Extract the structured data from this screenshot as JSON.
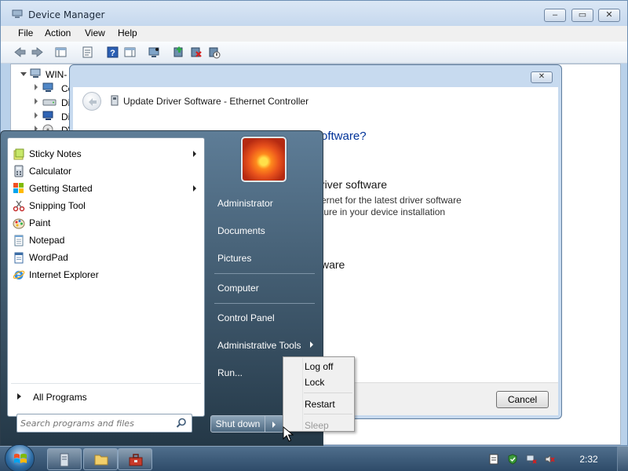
{
  "device_manager": {
    "title": "Device Manager",
    "menu": [
      "File",
      "Action",
      "View",
      "Help"
    ],
    "tree_root": "WIN-",
    "tree_items": [
      "Co",
      "Di",
      "Di",
      "DV"
    ],
    "buttons": {
      "minimize": "–",
      "maximize": "▭",
      "close": "✕"
    }
  },
  "dialog": {
    "title": "Update Driver Software - Ethernet Controller",
    "question_fragment": "oftware?",
    "option1_title_fragment": "river software",
    "option1_desc_line1": "ernet for the latest driver software",
    "option1_desc_line2": "ture in your device installation",
    "option2_title_fragment": "ware",
    "cancel_label": "Cancel",
    "close_glyph": "✕"
  },
  "start_menu": {
    "programs": [
      {
        "label": "Sticky Notes",
        "icon": "sticky-notes-icon",
        "has_arrow": true
      },
      {
        "label": "Calculator",
        "icon": "calculator-icon",
        "has_arrow": false
      },
      {
        "label": "Getting Started",
        "icon": "getting-started-icon",
        "has_arrow": true
      },
      {
        "label": "Snipping Tool",
        "icon": "snipping-tool-icon",
        "has_arrow": false
      },
      {
        "label": "Paint",
        "icon": "paint-icon",
        "has_arrow": false
      },
      {
        "label": "Notepad",
        "icon": "notepad-icon",
        "has_arrow": false
      },
      {
        "label": "WordPad",
        "icon": "wordpad-icon",
        "has_arrow": false
      },
      {
        "label": "Internet Explorer",
        "icon": "internet-explorer-icon",
        "has_arrow": false
      }
    ],
    "all_programs": "All Programs",
    "search_placeholder": "Search programs and files",
    "right_links": [
      "Administrator",
      "Documents",
      "Pictures",
      "Computer",
      "Control Panel",
      "Administrative Tools",
      "Run..."
    ],
    "shutdown_label": "Shut down"
  },
  "shutdown_submenu": {
    "items": [
      "Log off",
      "Lock",
      "Restart",
      "Sleep"
    ],
    "disabled": "Sleep"
  },
  "taskbar": {
    "clock": "2:32"
  },
  "colors": {
    "accent": "#2e4b69",
    "start_menu_bg": "#243847",
    "window_frame": "#b9d1ea"
  }
}
